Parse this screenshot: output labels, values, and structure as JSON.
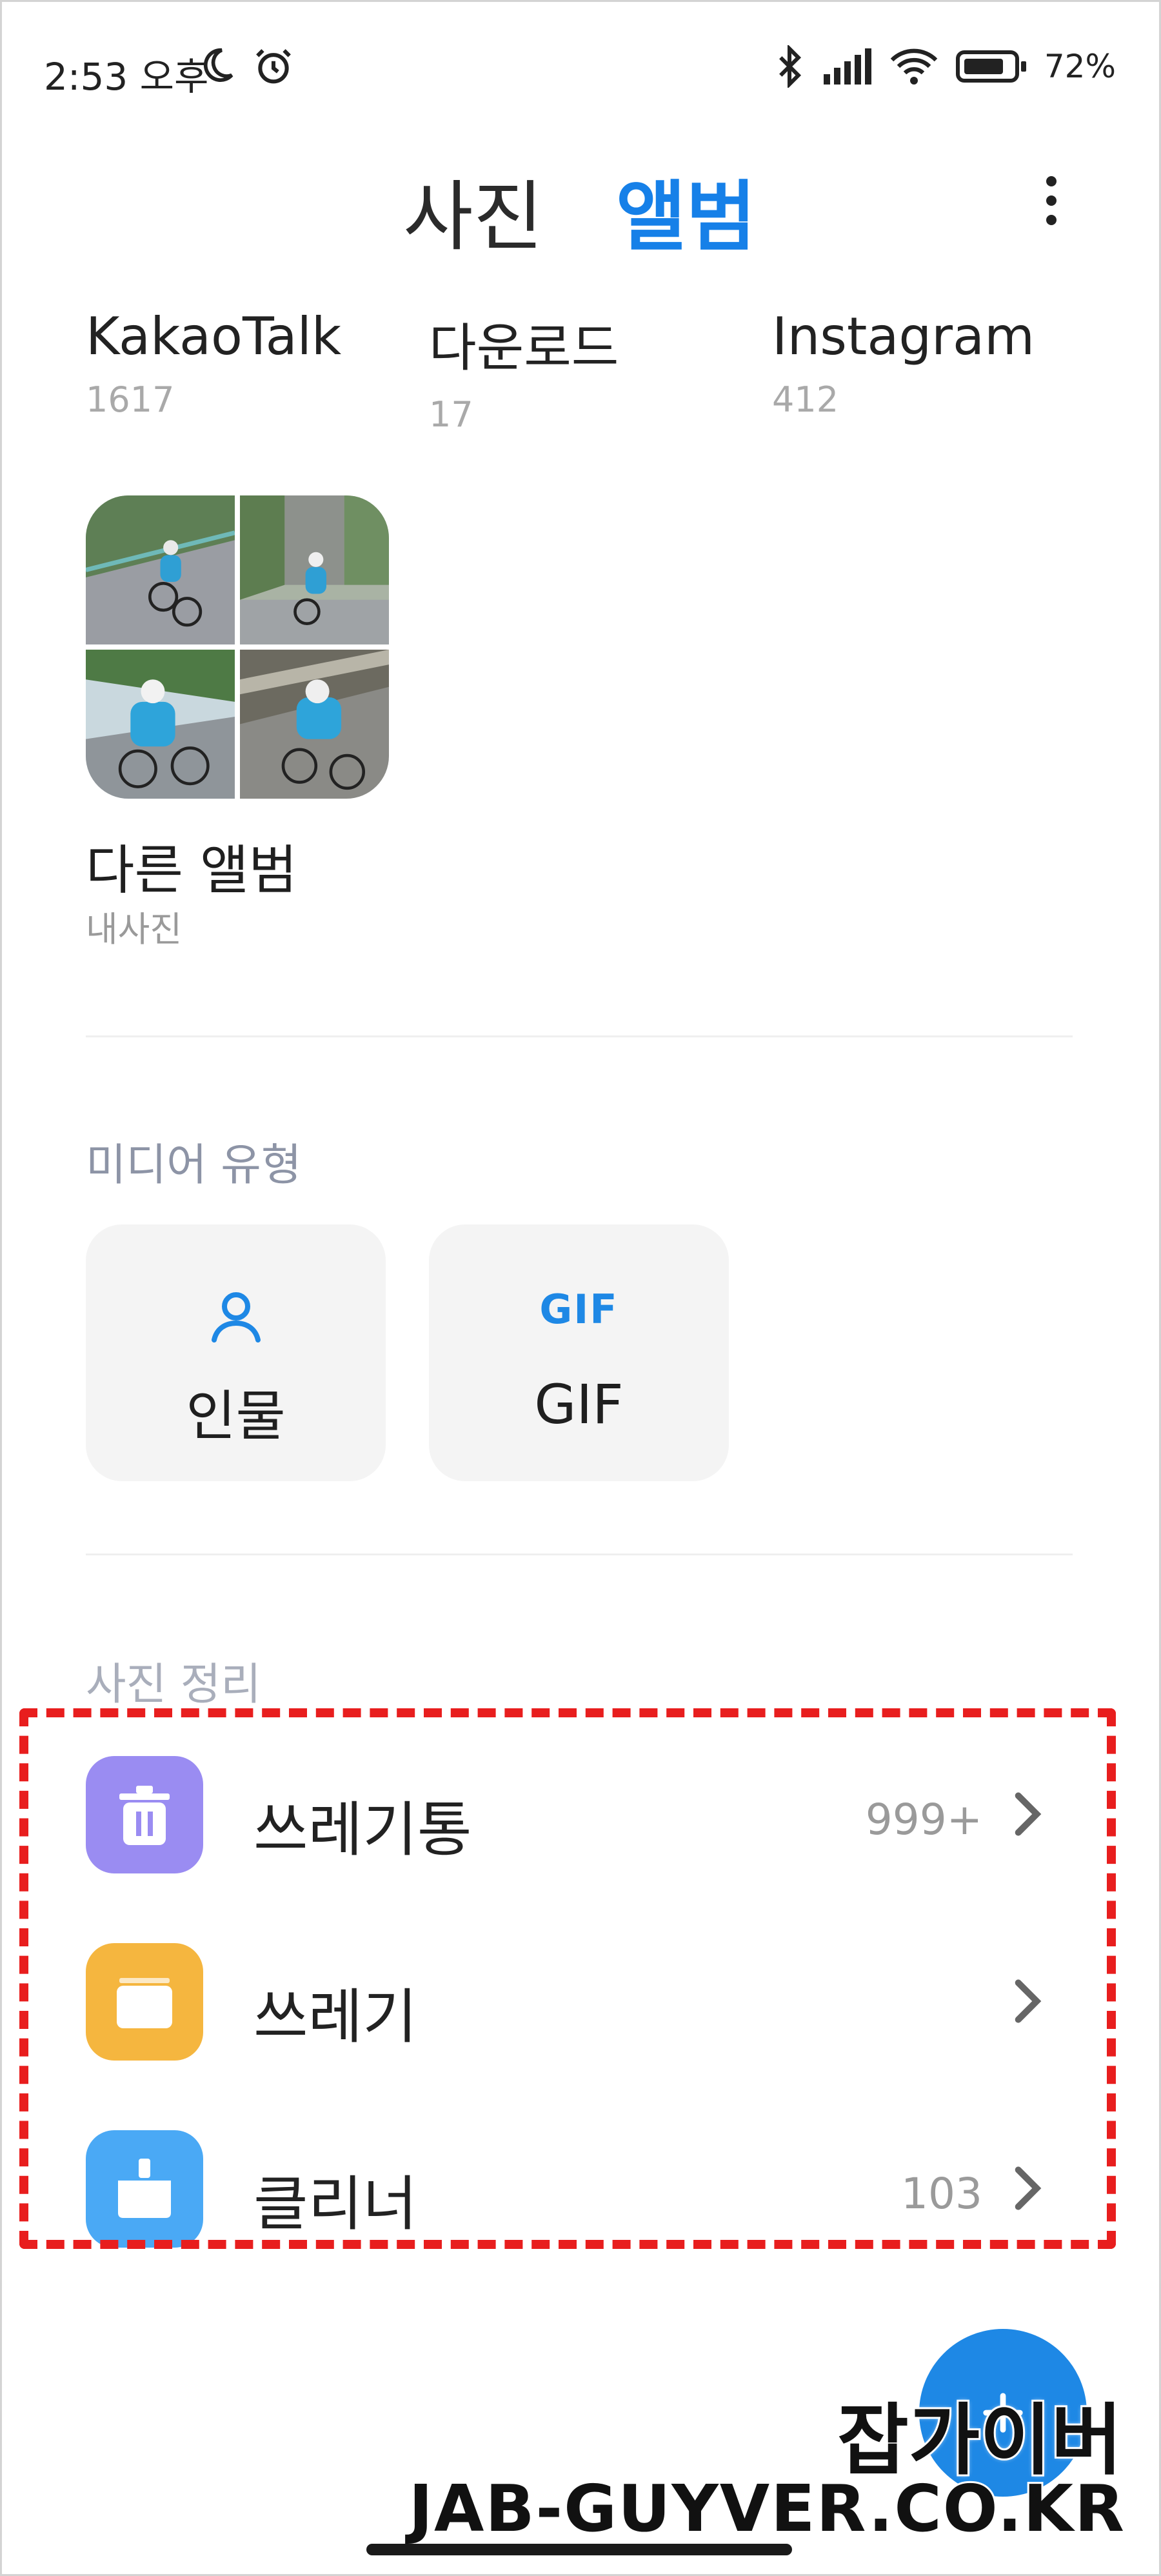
{
  "status_bar": {
    "time": "2:53 오후",
    "battery": "72%",
    "icons_left": [
      "moon-icon",
      "alarm-icon"
    ],
    "icons_right": [
      "bluetooth-icon",
      "signal-icon",
      "wifi-icon",
      "battery-icon"
    ]
  },
  "header": {
    "tabs": [
      {
        "label": "사진",
        "active": false
      },
      {
        "label": "앨범",
        "active": true
      }
    ],
    "accent_color": "#1680e8"
  },
  "albums": [
    {
      "name": "KakaoTalk",
      "count": "1617"
    },
    {
      "name": "다운로드",
      "count": "17"
    },
    {
      "name": "Instagram",
      "count": "412"
    }
  ],
  "other_album": {
    "title": "다른 앨범",
    "subtitle": "내사진"
  },
  "media_types": {
    "section_label": "미디어 유형",
    "items": [
      {
        "label": "인물",
        "icon": "person-icon"
      },
      {
        "label": "GIF",
        "icon": "GIF"
      }
    ]
  },
  "cleanup": {
    "section_label": "사진 정리",
    "items": [
      {
        "label": "쓰레기통",
        "count": "999+",
        "icon": "trash-icon",
        "color": "#9a8cf2"
      },
      {
        "label": "쓰레기",
        "count": "",
        "icon": "folder-icon",
        "color": "#f5b63f"
      },
      {
        "label": "클리너",
        "count": "103",
        "icon": "broom-icon",
        "color": "#4aa9f5"
      }
    ]
  },
  "watermark": {
    "korean": "잡가이버",
    "english": "JAB-GUYVER.CO.KR"
  }
}
